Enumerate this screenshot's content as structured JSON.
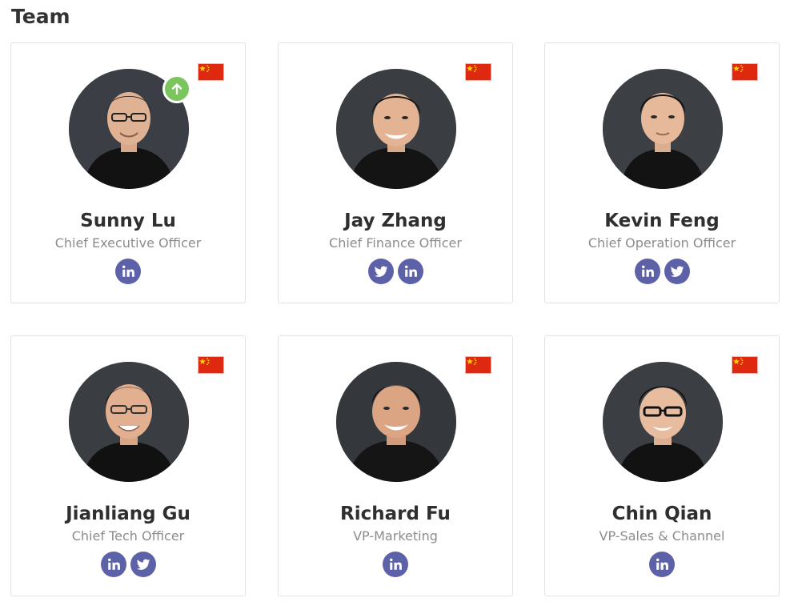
{
  "section": {
    "title": "Team"
  },
  "colors": {
    "social_button": "#5d61a8",
    "flag_red": "#de2910",
    "flag_star": "#ffde00",
    "badge_green": "#7cc55e"
  },
  "members": [
    {
      "name": "Sunny Lu",
      "role": "Chief Executive Officer",
      "flag": "china-flag",
      "badge": "arrow-up-icon",
      "socials": [
        "linkedin"
      ]
    },
    {
      "name": "Jay Zhang",
      "role": "Chief Finance Officer",
      "flag": "china-flag",
      "socials": [
        "twitter",
        "linkedin"
      ]
    },
    {
      "name": "Kevin Feng",
      "role": "Chief Operation Officer",
      "flag": "china-flag",
      "socials": [
        "linkedin",
        "twitter"
      ]
    },
    {
      "name": "Jianliang Gu",
      "role": "Chief Tech Officer",
      "flag": "china-flag",
      "socials": [
        "linkedin",
        "twitter"
      ]
    },
    {
      "name": "Richard Fu",
      "role": "VP-Marketing",
      "flag": "china-flag",
      "socials": [
        "linkedin"
      ]
    },
    {
      "name": "Chin Qian",
      "role": "VP-Sales & Channel",
      "flag": "china-flag",
      "socials": [
        "linkedin"
      ]
    }
  ]
}
